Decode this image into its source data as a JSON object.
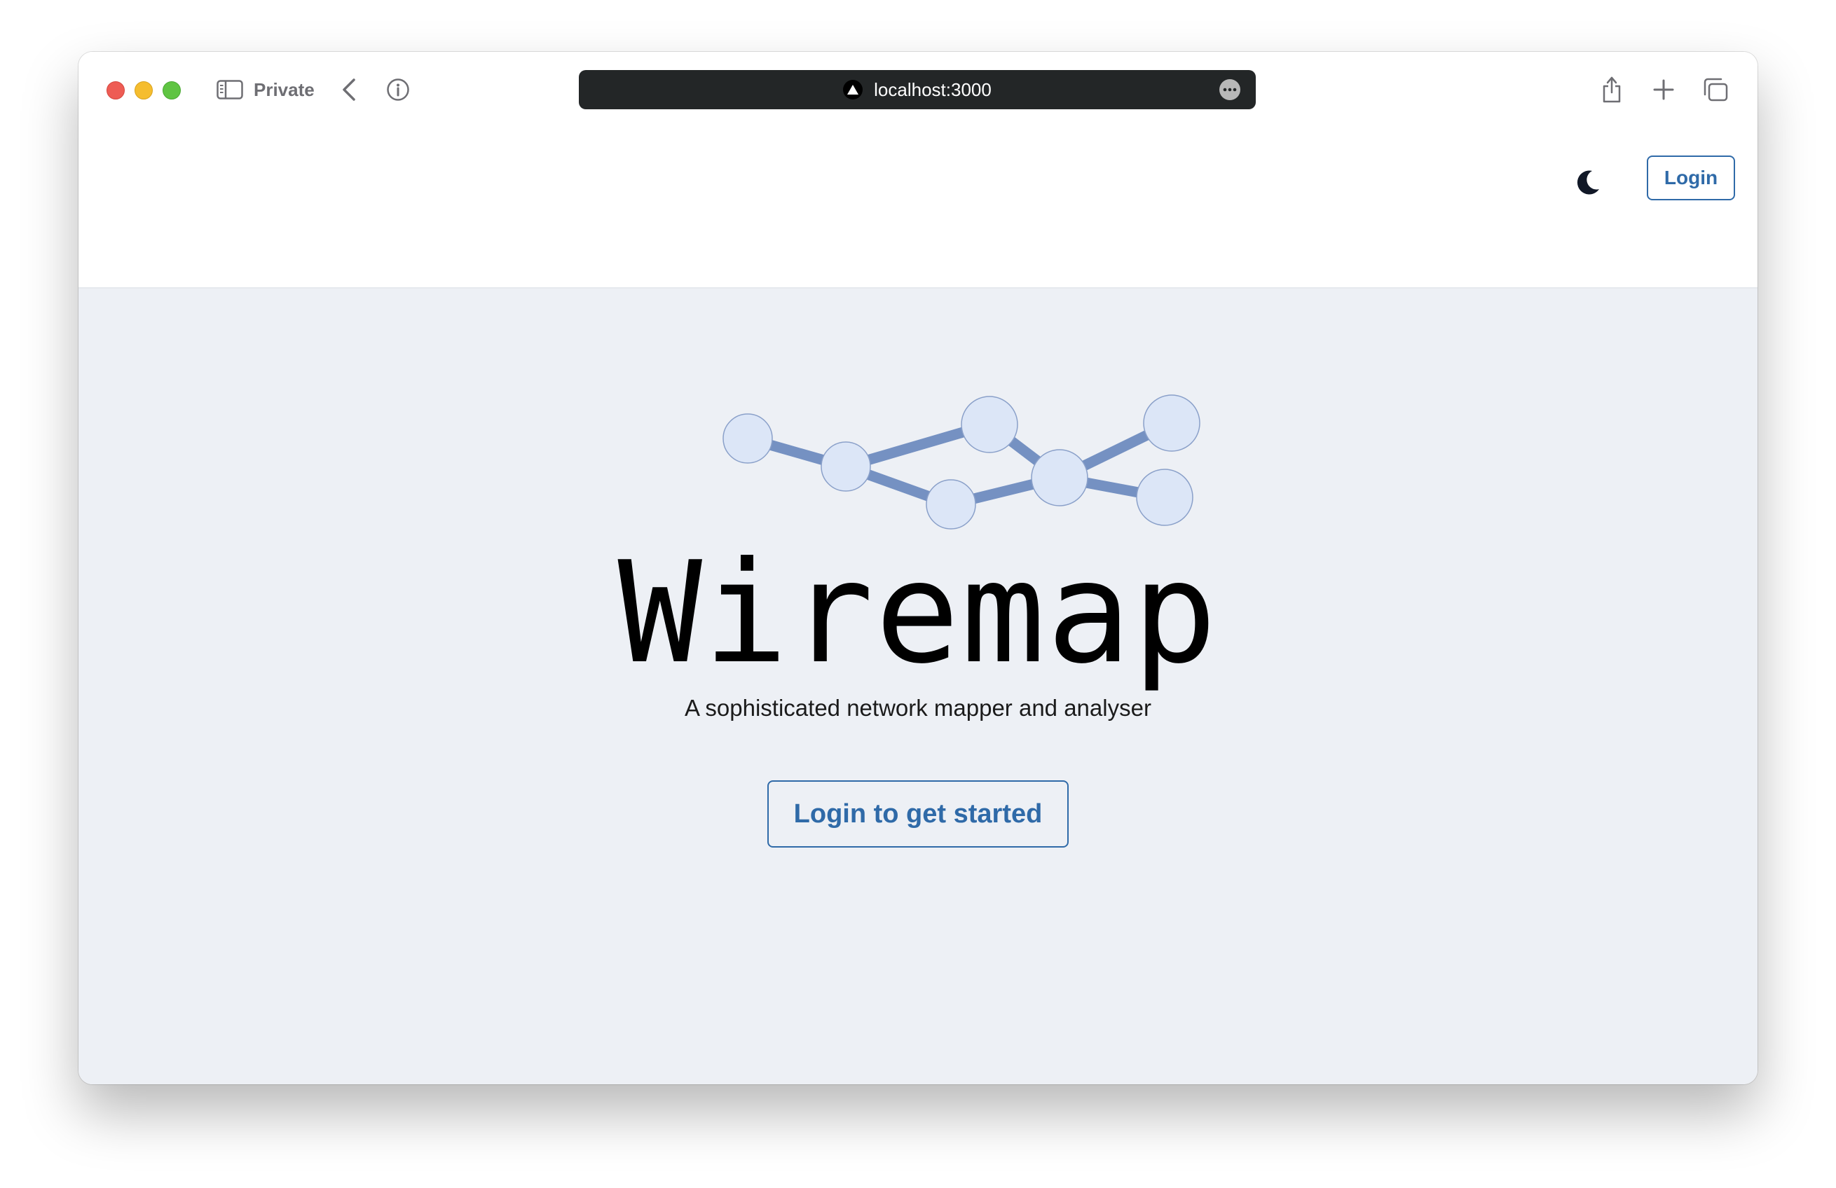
{
  "browser": {
    "mode_label": "Private",
    "address": "localhost:3000",
    "icons": {
      "sidebar_toggle": "sidebar-icon",
      "back": "chevron-left-icon",
      "info": "info-icon",
      "site": "triangle-icon",
      "more": "ellipsis-icon",
      "share": "share-icon",
      "new_tab": "plus-icon",
      "tab_overview": "tabs-icon"
    }
  },
  "header": {
    "theme_toggle_icon": "moon-icon",
    "login_label": "Login"
  },
  "hero": {
    "title": "Wiremap",
    "tagline": "A sophisticated network mapper and analyser",
    "cta_label": "Login to get started",
    "logo_icon": "network-graph-icon"
  },
  "colors": {
    "accent": "#2f6aa8",
    "page_background": "#edf0f5",
    "node_fill": "#dce6f7",
    "edge_color": "#7591c2"
  }
}
